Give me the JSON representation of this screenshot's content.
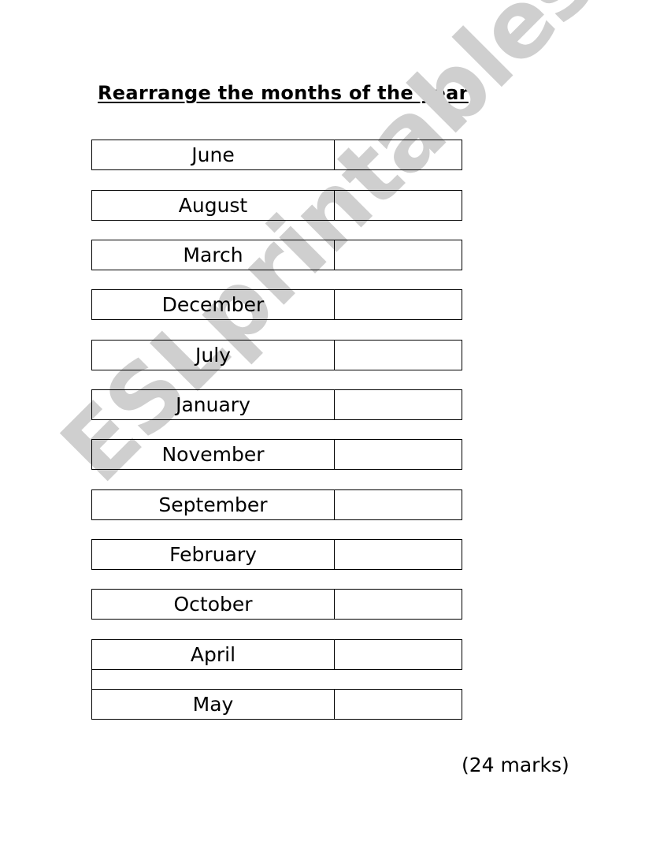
{
  "title": "Rearrange the months of the year",
  "months": [
    "June",
    "August",
    "March",
    "December",
    "July",
    "January",
    "November",
    "September",
    "February",
    "October",
    "April",
    "May"
  ],
  "answers": [
    "",
    "",
    "",
    "",
    "",
    "",
    "",
    "",
    "",
    "",
    "",
    ""
  ],
  "marks": "(24 marks)",
  "watermark": "ESLprintables.com"
}
